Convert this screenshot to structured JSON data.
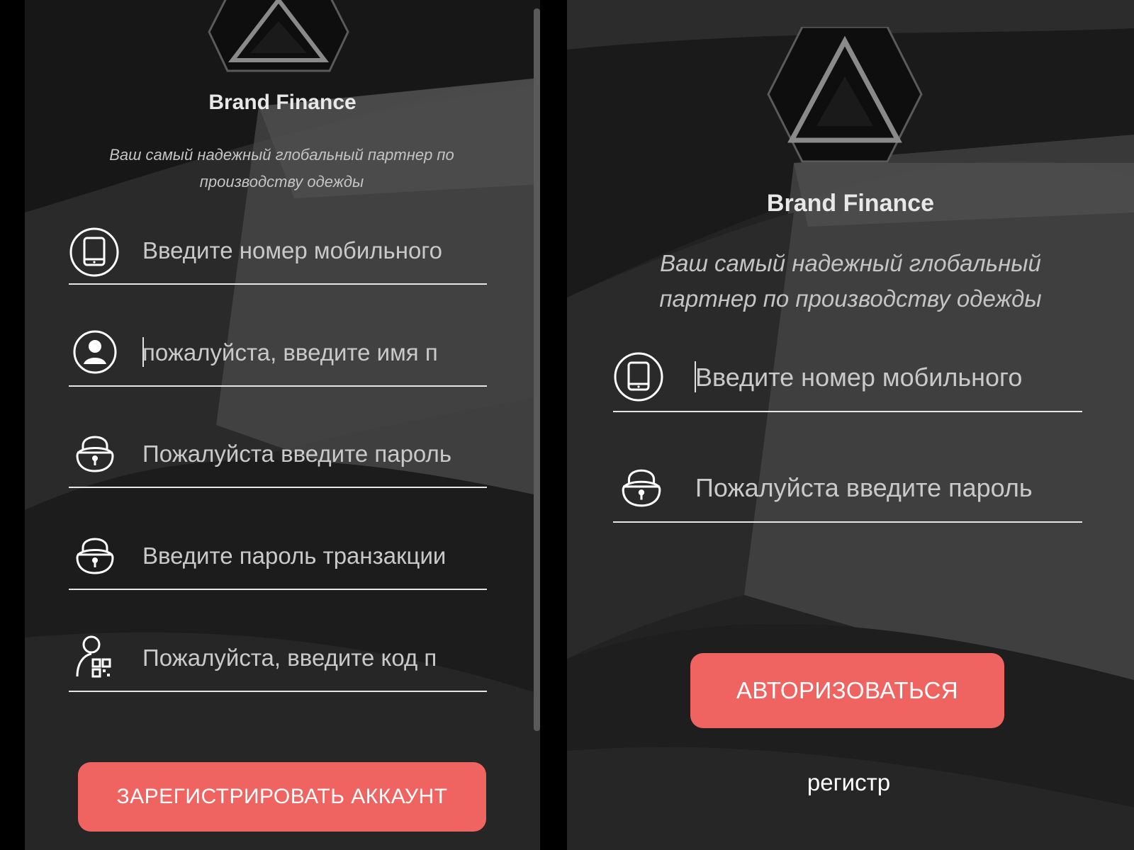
{
  "register_screen": {
    "brand": "Brand Finance",
    "tagline": "Ваш самый надежный глобальный партнер по производству одежды",
    "fields": [
      {
        "icon": "phone-icon",
        "placeholder": "Введите номер мобильного"
      },
      {
        "icon": "user-icon",
        "placeholder": "пожалуйста, введите имя п"
      },
      {
        "icon": "lock-icon",
        "placeholder": "Пожалуйста введите пароль"
      },
      {
        "icon": "lock-icon",
        "placeholder": "Введите пароль транзакции"
      },
      {
        "icon": "invite-code-icon",
        "placeholder": "Пожалуйста, введите код п"
      }
    ],
    "register_button": "ЗАРЕГИСТРИРОВАТЬ АККАУНТ"
  },
  "login_screen": {
    "brand": "Brand Finance",
    "tagline": "Ваш самый надежный глобальный партнер по производству одежды",
    "fields": [
      {
        "icon": "phone-icon",
        "placeholder": "Введите номер мобильного"
      },
      {
        "icon": "lock-icon",
        "placeholder": "Пожалуйста введите пароль"
      }
    ],
    "login_button": "АВТОРИЗОВАТЬСЯ",
    "register_link": "регистр"
  },
  "colors": {
    "accent": "#ef6461",
    "background": "#202020",
    "text": "#e8e8e8"
  }
}
